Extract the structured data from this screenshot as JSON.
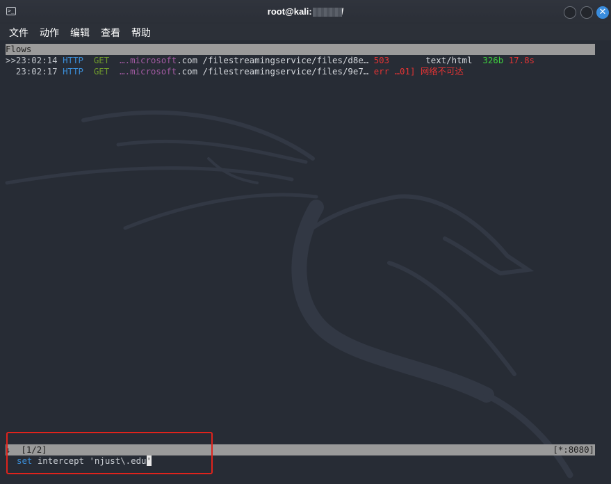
{
  "window": {
    "title": "root@kali: /home/",
    "icon": "terminal-icon",
    "controls": [
      "minimize-icon",
      "maximize-icon",
      "close-icon"
    ],
    "close_glyph": "✕"
  },
  "menu": [
    "文件",
    "动作",
    "编辑",
    "查看",
    "帮助"
  ],
  "flows": {
    "header": "Flows",
    "rows": [
      {
        "marker": ">>",
        "time": "23:02:14",
        "proto": "HTTP",
        "method": "GET",
        "host_prefix": "….microsoft",
        "host_suffix": ".com",
        "path": "/filestreamingservice/files/d8e…",
        "status": "503",
        "type": "text/html",
        "size": "326b",
        "duration": "17.8s"
      },
      {
        "marker": "  ",
        "time": "23:02:17",
        "proto": "HTTP",
        "method": "GET",
        "host_prefix": "….microsoft",
        "host_suffix": ".com",
        "path": "/filestreamingservice/files/9e7…",
        "status": "err",
        "error": "…01] 网络不可达"
      }
    ]
  },
  "status_bar": {
    "arrow": "↓",
    "position": "[1/2]",
    "listen": "[*:8080]"
  },
  "command": {
    "keyword": "set",
    "text": " intercept 'njust\\.edu",
    "cursor": "'"
  },
  "colors": {
    "highlight_box": "#e0231c",
    "accent_blue": "#3b8ed8",
    "error_red": "#e23434",
    "size_green": "#3ed03e"
  }
}
